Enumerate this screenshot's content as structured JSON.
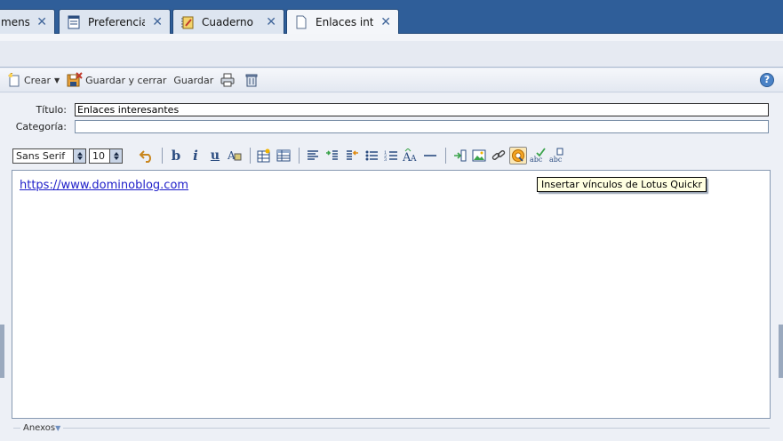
{
  "tabs": [
    {
      "label": "mens...",
      "icon": "mail-icon",
      "active": false
    },
    {
      "label": "Preferencias",
      "icon": "document-icon",
      "active": false
    },
    {
      "label": "Cuaderno",
      "icon": "notebook-icon",
      "active": false
    },
    {
      "label": "Enlaces inte...",
      "icon": "page-icon",
      "active": true
    }
  ],
  "actions": {
    "create_label": "Crear",
    "save_close_label": "Guardar y cerrar",
    "save_label": "Guardar",
    "help_label": "?"
  },
  "form": {
    "title_label": "Título:",
    "title_value": "Enlaces interesantes",
    "category_label": "Categoría:",
    "category_value": ""
  },
  "editor_toolbar": {
    "font_family": "Sans Serif",
    "font_size": "10"
  },
  "editor": {
    "link_text": "https://www.dominoblog.com"
  },
  "tooltip": "Insertar vínculos de Lotus Quickr",
  "attachments_label": "Anexos"
}
